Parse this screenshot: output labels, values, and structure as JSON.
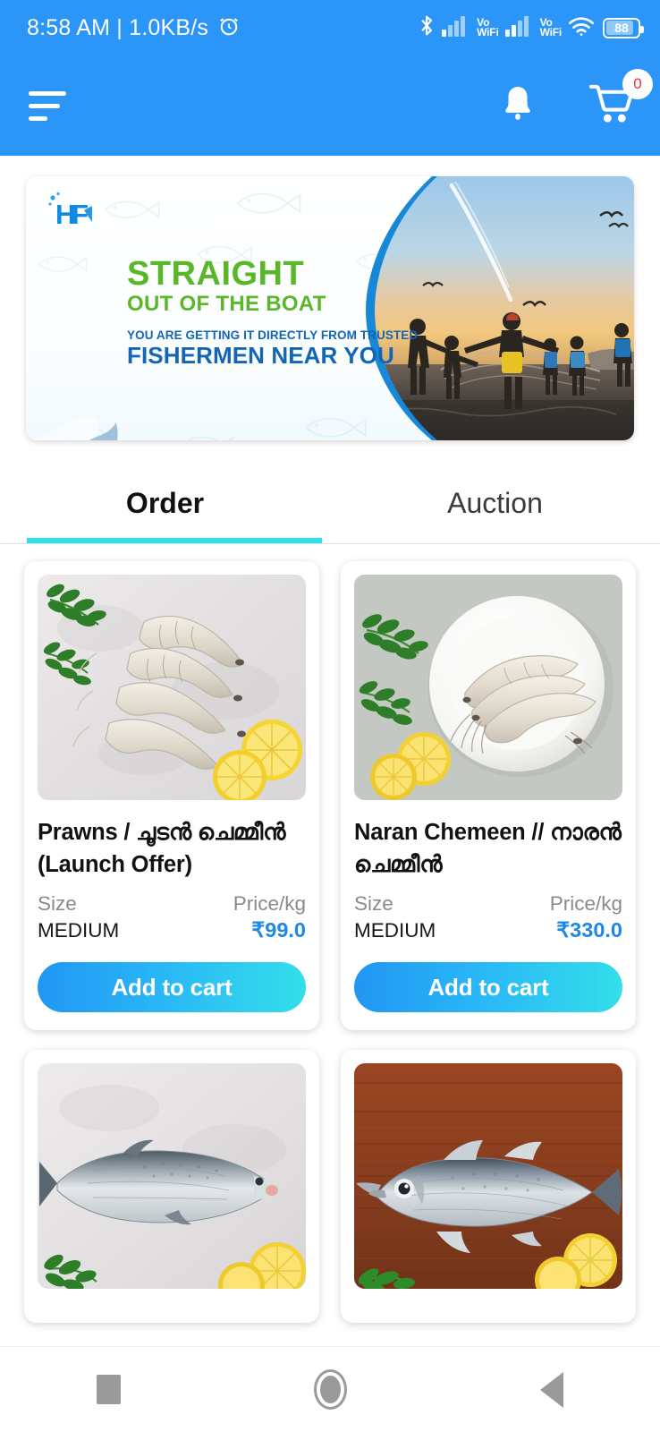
{
  "status_bar": {
    "clock": "8:58 AM | 1.0KB/s",
    "alarm_icon": "alarm-icon",
    "bluetooth_icon": "bluetooth-icon",
    "vowifi_1_top": "Vo",
    "vowifi_1_bottom": "WiFi",
    "vowifi_2_top": "Vo",
    "vowifi_2_bottom": "WiFi",
    "wifi_icon": "wifi-icon",
    "battery_level": "88"
  },
  "app_bar": {
    "menu_icon": "hamburger-menu-icon",
    "notifications_icon": "bell-icon",
    "cart_icon": "shopping-cart-icon",
    "cart_count": "0",
    "background_color": "#2B95F8"
  },
  "banner": {
    "logo_text": "HF",
    "headline": "STRAIGHT",
    "subheadline": "OUT OF THE BOAT",
    "tagline_small": "YOU ARE GETTING IT DIRECTLY FROM TRUSTED",
    "tagline_large": "FISHERMEN NEAR YOU",
    "headline_color": "#5BB72A",
    "tagline_color": "#1565B5",
    "photo_alt": "fishermen-pulling-nets-at-sunset"
  },
  "tabs": {
    "items": [
      {
        "label": "Order",
        "active": true
      },
      {
        "label": "Auction",
        "active": false
      }
    ],
    "indicator_color": "#2BE0F0"
  },
  "products": [
    {
      "title": "Prawns / ചൂടൻ ചെമ്മീൻ (Launch Offer)",
      "size_label": "Size",
      "price_label": "Price/kg",
      "size_value": "MEDIUM",
      "price_value": "₹99.0",
      "button_label": "Add to cart",
      "image_alt": "raw-prawns-on-marble-with-curry-leaves-and-lemon"
    },
    {
      "title": "Naran Chemeen // നാരൻ ചെമ്മീൻ",
      "size_label": "Size",
      "price_label": "Price/kg",
      "size_value": "MEDIUM",
      "price_value": "₹330.0",
      "button_label": "Add to cart",
      "image_alt": "prawns-on-white-plate-with-curry-leaves-and-lemon"
    },
    {
      "title": "",
      "size_label": "",
      "price_label": "",
      "size_value": "",
      "price_value": "",
      "button_label": "",
      "image_alt": "whole-mullet-fish-on-marble-with-leaves-and-lemon"
    },
    {
      "title": "",
      "size_label": "",
      "price_label": "",
      "size_value": "",
      "price_value": "",
      "button_label": "",
      "image_alt": "whole-sea-bass-on-wooden-board-with-lemon"
    }
  ],
  "nav_bar": {
    "recents_icon": "square-recents-icon",
    "home_icon": "circle-home-icon",
    "back_icon": "triangle-back-icon"
  }
}
